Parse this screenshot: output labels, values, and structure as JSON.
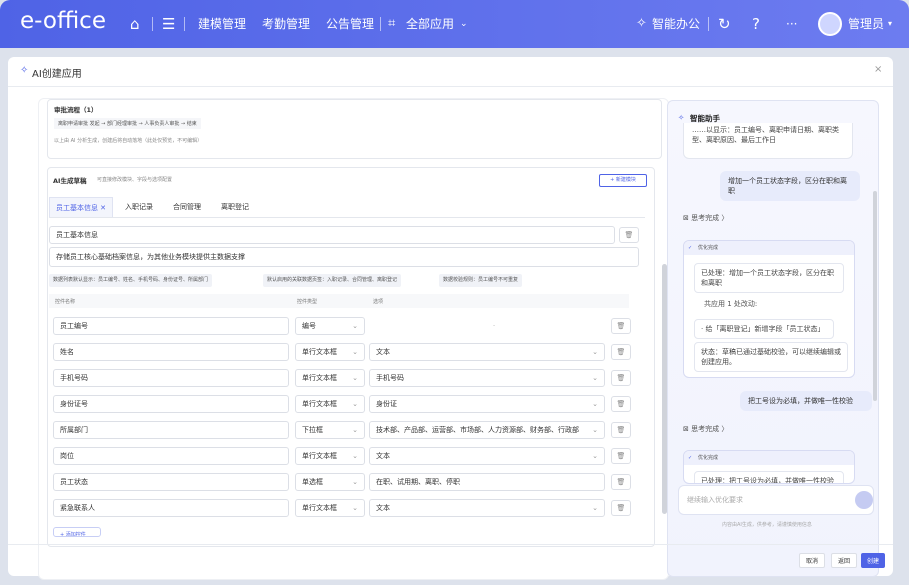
{
  "app": {
    "logo": "e-office",
    "nav": [
      "建模管理",
      "考勤管理",
      "公告管理",
      "全部应用"
    ],
    "smart": "智能办公",
    "ellipsis": "···",
    "user": "管理员"
  },
  "modal": {
    "title": "AI创建应用",
    "close": "×",
    "ai_icon": "✧"
  },
  "approval": {
    "title": "审批流程（1）",
    "flow": "离职申请审批 发起 → 部门经理审批 → 人事负责人审批 → 结束",
    "note": "以上由 AI 分析生成，创建后将自动落地（此处仅预览，不可编辑）"
  },
  "draft": {
    "title": "AI生成草稿",
    "hint": "可直接修改模块、字段与选项配置",
    "new_button": "+ 新建模块"
  },
  "tabs": [
    {
      "label": "员工基本信息 ✕"
    },
    {
      "label": "入职记录"
    },
    {
      "label": "合同管理"
    },
    {
      "label": "离职登记"
    }
  ],
  "module": {
    "name": "员工基本信息",
    "description": "存储员工核心基础档案信息，为其他业务模块提供主数据支撑"
  },
  "chips": [
    "数据列表默认显示：员工编号、姓名、手机号码、身份证号、所属部门",
    "默认启用的关联数据页签：入职记录、合同管理、离职登记",
    "数据校验规则：员工编号不可重复"
  ],
  "table": {
    "headers": [
      "控件名称",
      "控件类型",
      "选项"
    ],
    "rows": [
      {
        "name": "员工编号",
        "type": "编号",
        "option": "-"
      },
      {
        "name": "姓名",
        "type": "单行文本框",
        "option": "文本"
      },
      {
        "name": "手机号码",
        "type": "单行文本框",
        "option": "手机号码"
      },
      {
        "name": "身份证号",
        "type": "单行文本框",
        "option": "身份证"
      },
      {
        "name": "所属部门",
        "type": "下拉框",
        "option": "技术部、产品部、运营部、市场部、人力资源部、财务部、行政部"
      },
      {
        "name": "岗位",
        "type": "单行文本框",
        "option": "文本"
      },
      {
        "name": "员工状态",
        "type": "单选框",
        "option": "在职、试用期、离职、停职"
      },
      {
        "name": "紧急联系人",
        "type": "单行文本框",
        "option": "文本"
      }
    ],
    "add_field": "+ 添加控件"
  },
  "assistant": {
    "title": "智能助手",
    "msg_top": "……以显示：员工编号、离职申请日期、离职类型、离职原因、最后工作日",
    "user1": "增加一个员工状态字段，区分在职和离职",
    "think": "思考完成 〉",
    "done_label": "优化完成",
    "processed": "已处理：增加一个员工状态字段，区分在职和离职",
    "applied": "共应用 1 处改动:",
    "change": "· 给「离职登记」新增字段「员工状态」",
    "status": "状态：草稿已通过基础校验，可以继续编辑或创建应用。",
    "user2": "把工号设为必填，并做唯一性校验",
    "partial": "已处理：把工号设为必填，并做唯一性校验",
    "placeholder": "继续输入优化要求",
    "disclaimer": "内容由AI生成，供参考，请谨慎使用信息"
  },
  "footer": {
    "cancel": "取消",
    "back": "返回",
    "create": "创建"
  },
  "colors": {
    "primary": "#4f63e6",
    "header_gradient_end": "#6d7cf0"
  }
}
